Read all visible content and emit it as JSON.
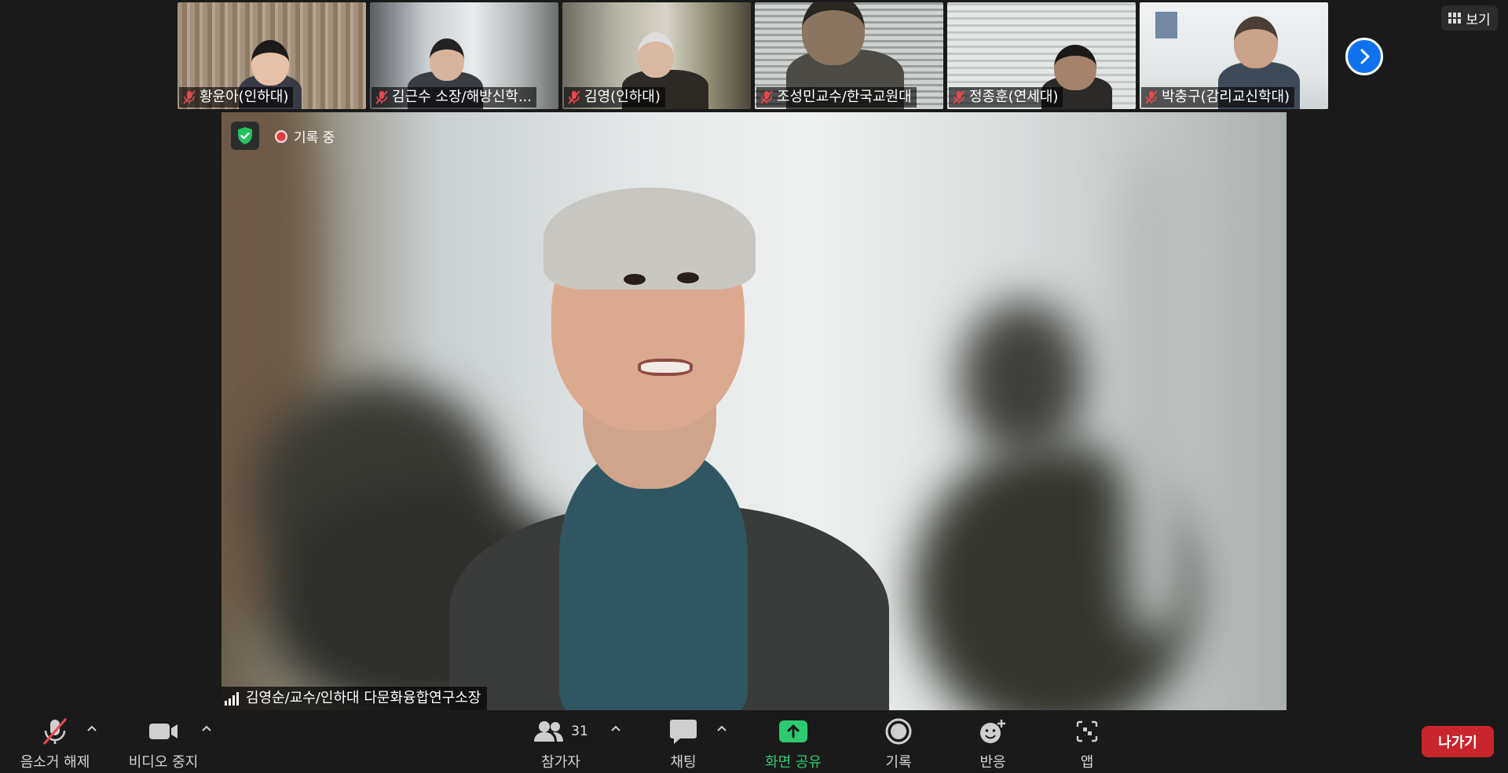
{
  "participants_strip": [
    {
      "name": "황윤아(인하대)"
    },
    {
      "name": "김근수 소장/해방신학..."
    },
    {
      "name": "김영(인하대)"
    },
    {
      "name": "조성민교수/한국교원대"
    },
    {
      "name": "정종훈(연세대)"
    },
    {
      "name": "박충구(감리교신학대)"
    }
  ],
  "view_button": {
    "label": "보기",
    "icon": "grid-icon"
  },
  "main": {
    "recording_label": "기록 중",
    "speaker_name": "김영순/교수/인하대 다문화융합연구소장"
  },
  "toolbar": {
    "audio_label": "음소거 해제",
    "video_label": "비디오 중지",
    "participants_label": "참가자",
    "participants_count": "31",
    "chat_label": "채팅",
    "share_label": "화면 공유",
    "record_label": "기록",
    "reactions_label": "반응",
    "apps_label": "앱",
    "leave_label": "나가기"
  },
  "colors": {
    "background": "#1a1a1a",
    "share_green": "#2dca70",
    "leave_red": "#c9252c",
    "accent_blue": "#0e72ed",
    "muted_red": "#e5484d"
  }
}
